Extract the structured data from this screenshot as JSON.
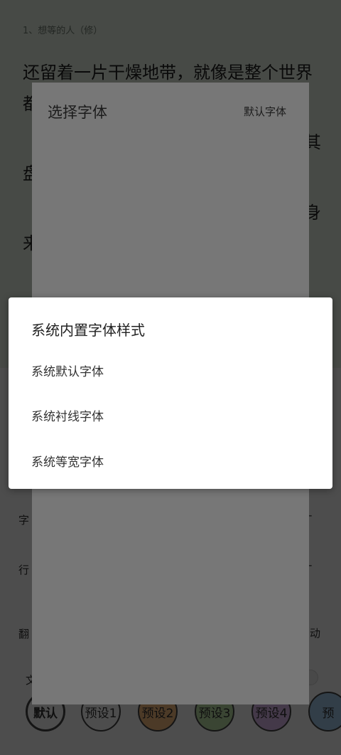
{
  "reader": {
    "chapter_title": "1、想等的人（修）",
    "lines": [
      "还留着一片干燥地带，就像是整个世界",
      "都",
      "其",
      "盘",
      "身",
      "来"
    ]
  },
  "settings": {
    "row_font_size": "字",
    "row_line_spacing": "行",
    "row_page_turn": "翻",
    "row_page_turn_right": "动",
    "row_text": "文",
    "presets": [
      "默认",
      "预设1",
      "预设2",
      "预设3",
      "预设4",
      "预"
    ],
    "preset_colors": [
      "#f3f3f3",
      "#f3f3f3",
      "#f0b77a",
      "#b9d9a0",
      "#d8b5e6",
      "#9fc4e3"
    ]
  },
  "font_sheet": {
    "title": "选择字体",
    "default_label": "默认字体"
  },
  "dialog": {
    "title": "系统内置字体样式",
    "items": [
      "系统默认字体",
      "系统衬线字体",
      "系统等宽字体"
    ]
  }
}
